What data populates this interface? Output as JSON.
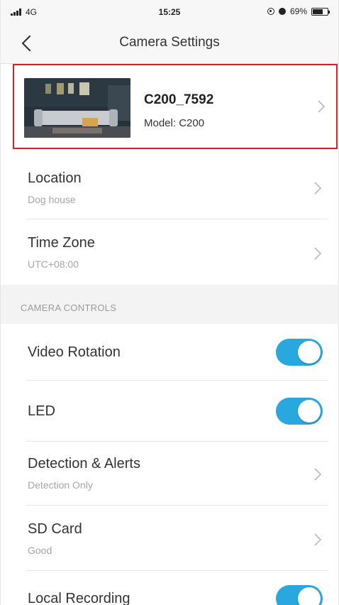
{
  "status_bar": {
    "carrier": "4G",
    "time": "15:25",
    "battery_percent": "69%",
    "battery_level": 0.69
  },
  "nav": {
    "title": "Camera Settings",
    "back_icon": "chevron-left-icon"
  },
  "device": {
    "name": "C200_7592",
    "model": "Model: C200"
  },
  "settings_top": [
    {
      "title": "Location",
      "subtitle": "Dog house"
    },
    {
      "title": "Time Zone",
      "subtitle": "UTC+08:00"
    }
  ],
  "section": {
    "label": "CAMERA CONTROLS"
  },
  "controls": {
    "video_rotation": {
      "title": "Video Rotation",
      "enabled": true
    },
    "led": {
      "title": "LED",
      "enabled": true
    },
    "detection": {
      "title": "Detection & Alerts",
      "subtitle": "Detection Only"
    },
    "sd_card": {
      "title": "SD Card",
      "subtitle": "Good"
    },
    "local_recording": {
      "title": "Local Recording",
      "enabled": true
    }
  },
  "colors": {
    "accent": "#29a8e0",
    "highlight_border": "#d0222a"
  }
}
